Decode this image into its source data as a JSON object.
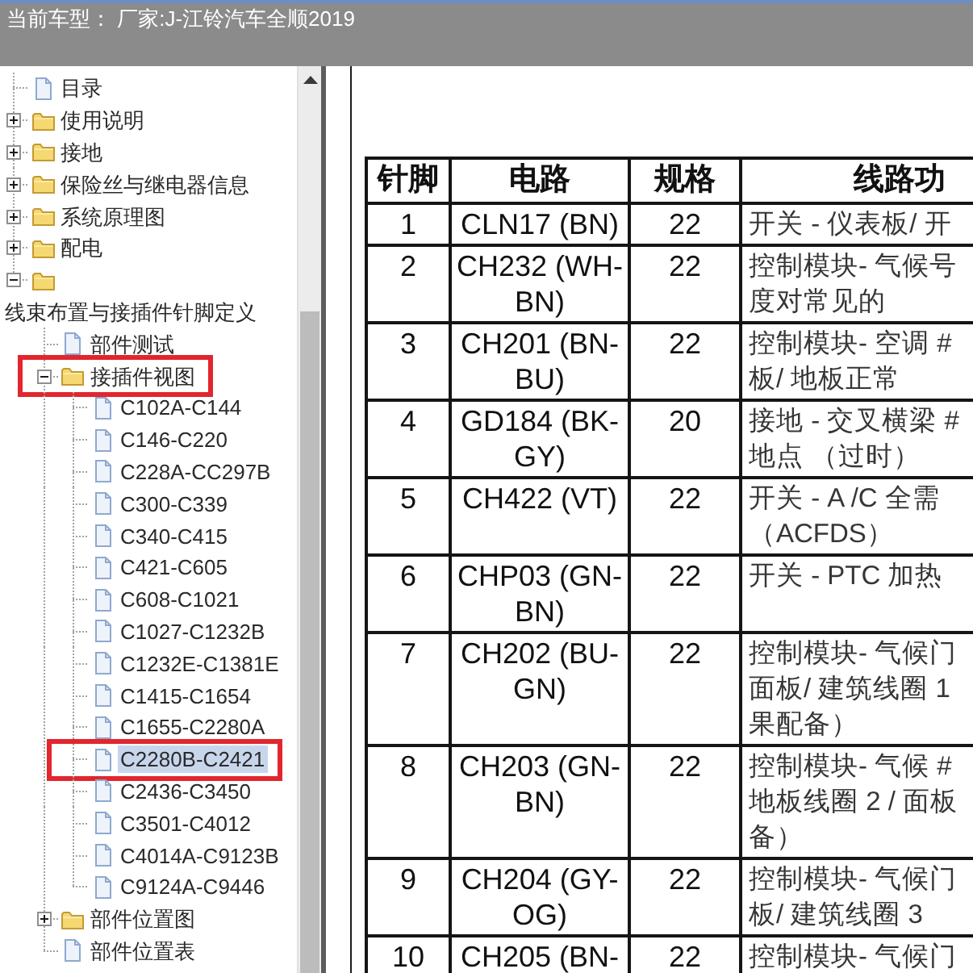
{
  "title_bar": {
    "text": "当前车型： 厂家:J-江铃汽车全顺2019"
  },
  "tree": {
    "items": [
      {
        "kind": "document",
        "label": "目录",
        "selected": false,
        "framed": false
      },
      {
        "kind": "folder",
        "label": "使用说明",
        "expanded": false,
        "selected": false,
        "framed": false
      },
      {
        "kind": "folder",
        "label": "接地",
        "expanded": false,
        "selected": false,
        "framed": false
      },
      {
        "kind": "folder",
        "label": "保险丝与继电器信息",
        "expanded": false,
        "selected": false,
        "framed": false
      },
      {
        "kind": "folder",
        "label": "系统原理图",
        "expanded": false,
        "selected": false,
        "framed": false
      },
      {
        "kind": "folder",
        "label": "配电",
        "expanded": false,
        "selected": false,
        "framed": false
      },
      {
        "kind": "folder",
        "label": "线束布置与接插件针脚定义",
        "expanded": true,
        "selected": false,
        "framed": false,
        "children": [
          {
            "kind": "document",
            "label": "部件测试",
            "selected": false,
            "framed": false
          },
          {
            "kind": "folder",
            "label": "接插件视图",
            "expanded": true,
            "selected": false,
            "framed": true,
            "children": [
              {
                "kind": "document",
                "label": "C102A-C144",
                "selected": false,
                "framed": false
              },
              {
                "kind": "document",
                "label": "C146-C220",
                "selected": false,
                "framed": false
              },
              {
                "kind": "document",
                "label": "C228A-CC297B",
                "selected": false,
                "framed": false
              },
              {
                "kind": "document",
                "label": "C300-C339",
                "selected": false,
                "framed": false
              },
              {
                "kind": "document",
                "label": "C340-C415",
                "selected": false,
                "framed": false
              },
              {
                "kind": "document",
                "label": "C421-C605",
                "selected": false,
                "framed": false
              },
              {
                "kind": "document",
                "label": "C608-C1021",
                "selected": false,
                "framed": false
              },
              {
                "kind": "document",
                "label": "C1027-C1232B",
                "selected": false,
                "framed": false
              },
              {
                "kind": "document",
                "label": "C1232E-C1381E",
                "selected": false,
                "framed": false
              },
              {
                "kind": "document",
                "label": "C1415-C1654",
                "selected": false,
                "framed": false
              },
              {
                "kind": "document",
                "label": "C1655-C2280A",
                "selected": false,
                "framed": false
              },
              {
                "kind": "document",
                "label": "C2280B-C2421",
                "selected": true,
                "framed": true
              },
              {
                "kind": "document",
                "label": "C2436-C3450",
                "selected": false,
                "framed": false
              },
              {
                "kind": "document",
                "label": "C3501-C4012",
                "selected": false,
                "framed": false
              },
              {
                "kind": "document",
                "label": "C4014A-C9123B",
                "selected": false,
                "framed": false
              },
              {
                "kind": "document",
                "label": "C9124A-C9446",
                "selected": false,
                "framed": false
              }
            ]
          },
          {
            "kind": "folder",
            "label": "部件位置图",
            "expanded": false,
            "selected": false,
            "framed": false
          },
          {
            "kind": "document",
            "label": "部件位置表",
            "selected": false,
            "framed": false
          }
        ]
      }
    ]
  },
  "document": {
    "table": {
      "columns": [
        "针脚",
        "电路",
        "规格",
        "线路功"
      ],
      "rows": [
        {
          "pin": "1",
          "circuit": "CLN17 (BN)",
          "gauge": "22",
          "function": "开关 - 仪表板/ 开"
        },
        {
          "pin": "2",
          "circuit": "CH232 (WH-BN)",
          "gauge": "22",
          "function": "控制模块- 气候号度对常见的"
        },
        {
          "pin": "3",
          "circuit": "CH201 (BN-BU)",
          "gauge": "22",
          "function": "控制模块- 空调 # 板/ 地板正常"
        },
        {
          "pin": "4",
          "circuit": "GD184 (BK-GY)",
          "gauge": "20",
          "function": "接地 - 交叉横梁 # 地点 （过时）"
        },
        {
          "pin": "5",
          "circuit": "CH422 (VT)",
          "gauge": "22",
          "function": "开关 - A /C 全需（ACFDS）"
        },
        {
          "pin": "6",
          "circuit": "CHP03 (GN-BN)",
          "gauge": "22",
          "function": "开关 - PTC 加热"
        },
        {
          "pin": "7",
          "circuit": "CH202 (BU-GN)",
          "gauge": "22",
          "function": "控制模块- 气候门面板/ 建筑线圈 1 果配备）"
        },
        {
          "pin": "8",
          "circuit": "CH203 (GN-BN)",
          "gauge": "22",
          "function": "控制模块- 气候 # 地板线圈 2 / 面板备）"
        },
        {
          "pin": "9",
          "circuit": "CH204 (GY-OG)",
          "gauge": "22",
          "function": "控制模块- 气候门板/ 建筑线圈 3"
        },
        {
          "pin": "10",
          "circuit": "CH205 (BN-",
          "gauge": "22",
          "function": "控制模块- 气候门"
        }
      ]
    }
  }
}
